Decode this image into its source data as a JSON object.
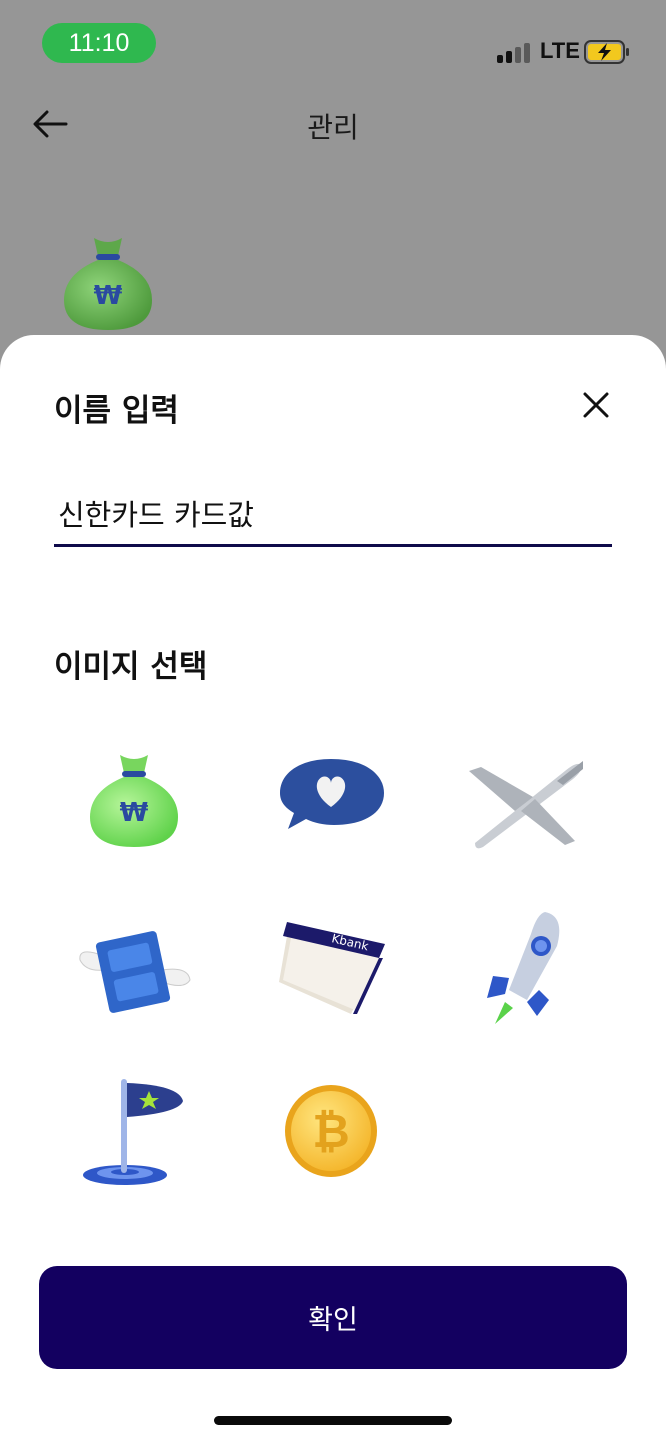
{
  "status_bar": {
    "time": "11:10",
    "network": "LTE"
  },
  "nav": {
    "title": "관리",
    "back_icon": "back-arrow-icon"
  },
  "background": {
    "selected_image": "money-bag-icon"
  },
  "sheet": {
    "title": "이름 입력",
    "close_icon": "close-icon",
    "name_input_value": "신한카드 카드값",
    "image_section_title": "이미지 선택",
    "image_options": [
      "money-bag-icon",
      "heart-speech-bubble-icon",
      "airplane-icon",
      "winged-cash-icon",
      "kbank-passbook-icon",
      "rocket-icon",
      "flag-icon",
      "bitcoin-icon"
    ],
    "passbook_label": "Kbank",
    "confirm_label": "확인"
  },
  "colors": {
    "primary": "#130060",
    "status_pill": "#2fb84f",
    "overlay": "#969696"
  }
}
